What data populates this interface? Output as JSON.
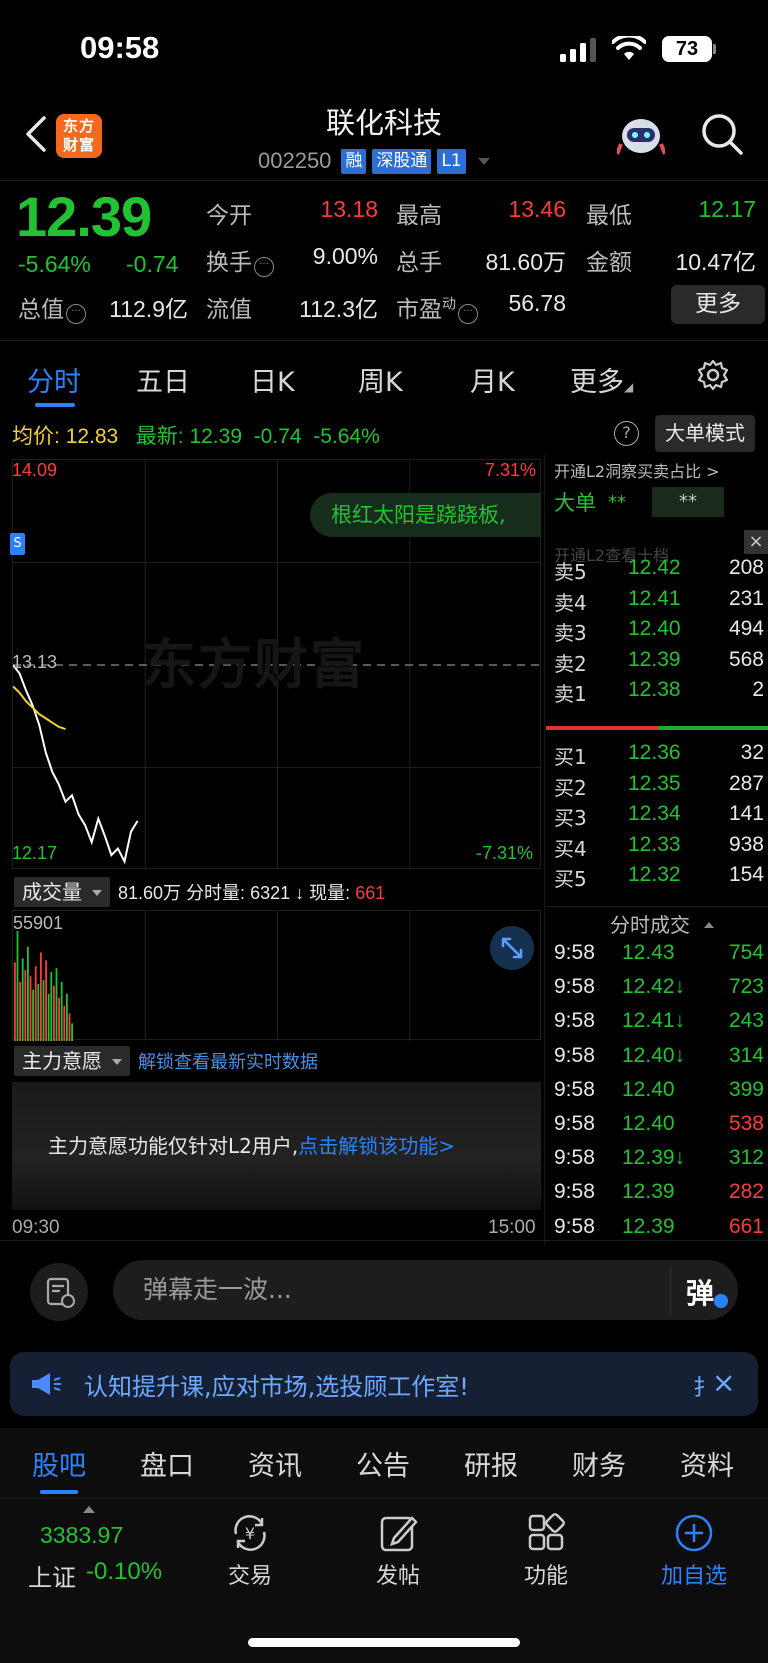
{
  "status_bar": {
    "time": "09:58",
    "battery": "73"
  },
  "header": {
    "logo_text": "东方\n财富",
    "stock_name": "联化科技",
    "stock_code": "002250",
    "tags": [
      "融",
      "深股通",
      "L1"
    ]
  },
  "quote": {
    "price": "12.39",
    "pct": "-5.64%",
    "change": "-0.74",
    "open_label": "今开",
    "open": "13.18",
    "high_label": "最高",
    "high": "13.46",
    "low_label": "最低",
    "low": "12.17",
    "turnover_label": "换手",
    "turnover": "9.00%",
    "volume_label": "总手",
    "volume": "81.60万",
    "amount_label": "金额",
    "amount": "10.47亿",
    "mktcap_label": "总值",
    "mktcap": "112.9亿",
    "float_label": "流值",
    "float_cap": "112.3亿",
    "pe_label": "市盈",
    "pe_sup": "动",
    "pe": "56.78",
    "more_label": "更多"
  },
  "tabs": [
    "分时",
    "五日",
    "日K",
    "周K",
    "月K",
    "更多"
  ],
  "avg_line": {
    "avg_label": "均价:",
    "avg": "12.83",
    "latest_label": "最新:",
    "latest": "12.39",
    "change": "-0.74",
    "pct": "-5.64%",
    "big_order_mode": "大单模式"
  },
  "chart": {
    "high_price": "14.09",
    "high_pct": "7.31%",
    "mid_price": "13.13",
    "low_price": "12.17",
    "low_pct": "-7.31%",
    "danmu": "根红太阳是跷跷板,",
    "watermark": "东方财富",
    "marker": "S",
    "start_time": "09:30",
    "end_time": "15:00"
  },
  "chart_data": {
    "type": "line",
    "ylim": [
      12.17,
      14.09
    ],
    "reference": 13.13,
    "series": [
      {
        "values": [
          13.13,
          13.09,
          13.01,
          12.94,
          12.85,
          12.72,
          12.63,
          12.57,
          12.49,
          12.52,
          12.43,
          12.38,
          12.3,
          12.41,
          12.33,
          12.24,
          12.27,
          12.21,
          12.35,
          12.4
        ]
      },
      {
        "values": [
          13.03,
          13.0,
          12.96,
          12.93,
          12.9,
          12.88,
          12.86,
          12.84,
          12.83
        ]
      }
    ],
    "volume": {
      "max_label": "55901",
      "bars": [
        {
          "v": 40000,
          "up": true
        },
        {
          "v": 55901,
          "up": false
        },
        {
          "v": 30000,
          "up": true
        },
        {
          "v": 42000,
          "up": false
        },
        {
          "v": 36000,
          "up": true
        },
        {
          "v": 48000,
          "up": false
        },
        {
          "v": 33000,
          "up": true
        },
        {
          "v": 26000,
          "up": false
        },
        {
          "v": 38000,
          "up": true
        },
        {
          "v": 29000,
          "up": false
        },
        {
          "v": 45000,
          "up": true
        },
        {
          "v": 31000,
          "up": false
        },
        {
          "v": 41000,
          "up": true
        },
        {
          "v": 24000,
          "up": false
        },
        {
          "v": 35000,
          "up": false
        },
        {
          "v": 28000,
          "up": true
        },
        {
          "v": 37000,
          "up": false
        },
        {
          "v": 22000,
          "up": true
        },
        {
          "v": 30000,
          "up": false
        },
        {
          "v": 18000,
          "up": true
        },
        {
          "v": 24000,
          "up": false
        },
        {
          "v": 14000,
          "up": true
        },
        {
          "v": 9000,
          "up": false
        }
      ]
    }
  },
  "volume_row": {
    "selector": "成交量",
    "total": "81.60万",
    "minute_label": "分时量:",
    "minute": "6321",
    "arrow": "↓",
    "current_label": "现量:",
    "current": "661"
  },
  "willingness": {
    "selector": "主力意愿",
    "unlock_link": "解锁查看最新实时数据",
    "message": "主力意愿功能仅针对L2用户,",
    "message_link": "点击解锁该功能>"
  },
  "right_panel": {
    "l2_promo": "开通L2洞察买卖占比 >",
    "big_order_label": "大单",
    "big_order_val": "**",
    "big_order_box": "**",
    "close": "×",
    "ghost": "开通L2查看十档",
    "asks": [
      {
        "label": "卖5",
        "price": "12.42",
        "qty": "208",
        "color": "#22c232"
      },
      {
        "label": "卖4",
        "price": "12.41",
        "qty": "231",
        "color": "#22c232"
      },
      {
        "label": "卖3",
        "price": "12.40",
        "qty": "494",
        "color": "#22c232"
      },
      {
        "label": "卖2",
        "price": "12.39",
        "qty": "568",
        "color": "#22c232"
      },
      {
        "label": "卖1",
        "price": "12.38",
        "qty": "2",
        "color": "#22c232"
      }
    ],
    "bids": [
      {
        "label": "买1",
        "price": "12.36",
        "qty": "32",
        "color": "#22c232"
      },
      {
        "label": "买2",
        "price": "12.35",
        "qty": "287",
        "color": "#22c232"
      },
      {
        "label": "买3",
        "price": "12.34",
        "qty": "141",
        "color": "#22c232"
      },
      {
        "label": "买4",
        "price": "12.33",
        "qty": "938",
        "color": "#22c232"
      },
      {
        "label": "买5",
        "price": "12.32",
        "qty": "154",
        "color": "#22c232"
      }
    ],
    "ticks_header": "分时成交",
    "ticks": [
      {
        "time": "9:58",
        "price": "12.43",
        "qty": "754",
        "qcolor": "#22c232"
      },
      {
        "time": "9:58",
        "price": "12.42↓",
        "qty": "723",
        "qcolor": "#22c232"
      },
      {
        "time": "9:58",
        "price": "12.41↓",
        "qty": "243",
        "qcolor": "#22c232"
      },
      {
        "time": "9:58",
        "price": "12.40↓",
        "qty": "314",
        "qcolor": "#22c232"
      },
      {
        "time": "9:58",
        "price": "12.40",
        "qty": "399",
        "qcolor": "#22c232"
      },
      {
        "time": "9:58",
        "price": "12.40",
        "qty": "538",
        "qcolor": "#ff3b3b"
      },
      {
        "time": "9:58",
        "price": "12.39↓",
        "qty": "312",
        "qcolor": "#22c232"
      },
      {
        "time": "9:58",
        "price": "12.39",
        "qty": "282",
        "qcolor": "#ff3b3b"
      },
      {
        "time": "9:58",
        "price": "12.39",
        "qty": "661",
        "qcolor": "#ff3b3b"
      }
    ]
  },
  "comment_bar": {
    "placeholder": "弹幕走一波...",
    "send": "弹"
  },
  "banner": {
    "text": "认知提升课,应对市场,选投顾工作室!",
    "sep": "扌",
    "close": "×"
  },
  "sub_tabs": [
    "股吧",
    "盘口",
    "资讯",
    "公告",
    "研报",
    "财务",
    "资料"
  ],
  "bottom_nav": {
    "index_value": "3383.97",
    "index_name": "上证",
    "index_pct": "-0.10%",
    "items": [
      "交易",
      "发帖",
      "功能",
      "加自选"
    ]
  },
  "colors": {
    "up": "#ff3b3b",
    "down": "#22c232",
    "accent": "#2b82ff",
    "avg_line": "#f2d230"
  }
}
